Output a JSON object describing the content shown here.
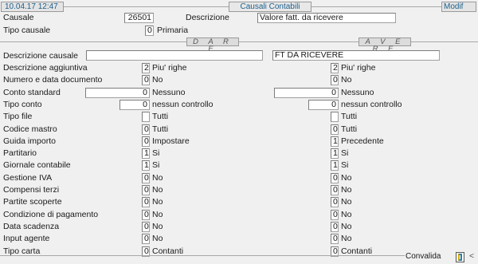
{
  "header": {
    "date_time": "10.04.17 12:47",
    "window_title": "Causali Contabili",
    "mode": "Modif"
  },
  "top": {
    "causale_label": "Causale",
    "causale_value": "26501",
    "descrizione_label": "Descrizione",
    "descrizione_value": "Valore fatt. da ricevere",
    "tipo_causale_label": "Tipo causale",
    "tipo_causale_value": "0",
    "tipo_causale_desc": "Primaria"
  },
  "sections": {
    "dare": "D A R E",
    "avere": "A V E R E"
  },
  "descrizione_causale": {
    "label": "Descrizione causale",
    "dare": "",
    "avere": "FT DA RICEVERE"
  },
  "rows": [
    {
      "label": "Descrizione aggiuntiva",
      "dare_value": "2",
      "dare_desc": "Piu' righe",
      "avere_value": "2",
      "avere_desc": "Piu' righe"
    },
    {
      "label": "Numero e data documento",
      "dare_value": "0",
      "dare_desc": "No",
      "avere_value": "0",
      "avere_desc": "No"
    },
    {
      "label": "Conto standard",
      "dare_value": "0",
      "dare_desc": "Nessuno",
      "avere_value": "0",
      "avere_desc": "Nessuno"
    },
    {
      "label": "Tipo conto",
      "dare_value": "0",
      "dare_desc": "nessun controllo",
      "avere_value": "0",
      "avere_desc": "nessun controllo"
    },
    {
      "label": "Tipo file",
      "dare_value": "",
      "dare_desc": "Tutti",
      "avere_value": "",
      "avere_desc": "Tutti"
    },
    {
      "label": "Codice mastro",
      "dare_value": "0",
      "dare_desc": "Tutti",
      "avere_value": "0",
      "avere_desc": "Tutti"
    },
    {
      "label": "Guida importo",
      "dare_value": "0",
      "dare_desc": "Impostare",
      "avere_value": "1",
      "avere_desc": "Precedente"
    },
    {
      "label": "Partitario",
      "dare_value": "1",
      "dare_desc": "Si",
      "avere_value": "1",
      "avere_desc": "Si"
    },
    {
      "label": "Giornale contabile",
      "dare_value": "1",
      "dare_desc": "Si",
      "avere_value": "1",
      "avere_desc": "Si"
    },
    {
      "label": "Gestione IVA",
      "dare_value": "0",
      "dare_desc": "No",
      "avere_value": "0",
      "avere_desc": "No"
    },
    {
      "label": "Compensi terzi",
      "dare_value": "0",
      "dare_desc": "No",
      "avere_value": "0",
      "avere_desc": "No"
    },
    {
      "label": "Partite scoperte",
      "dare_value": "0",
      "dare_desc": "No",
      "avere_value": "0",
      "avere_desc": "No"
    },
    {
      "label": "Condizione di pagamento",
      "dare_value": "0",
      "dare_desc": "No",
      "avere_value": "0",
      "avere_desc": "No"
    },
    {
      "label": "Data scadenza",
      "dare_value": "0",
      "dare_desc": "No",
      "avere_value": "0",
      "avere_desc": "No"
    },
    {
      "label": "Input agente",
      "dare_value": "0",
      "dare_desc": "No",
      "avere_value": "0",
      "avere_desc": "No"
    },
    {
      "label": "Tipo carta",
      "dare_value": "0",
      "dare_desc": "Contanti",
      "avere_value": "0",
      "avere_desc": "Contanti"
    }
  ],
  "footer": {
    "convalida_label": "Convalida",
    "arrow_glyph": "<"
  }
}
